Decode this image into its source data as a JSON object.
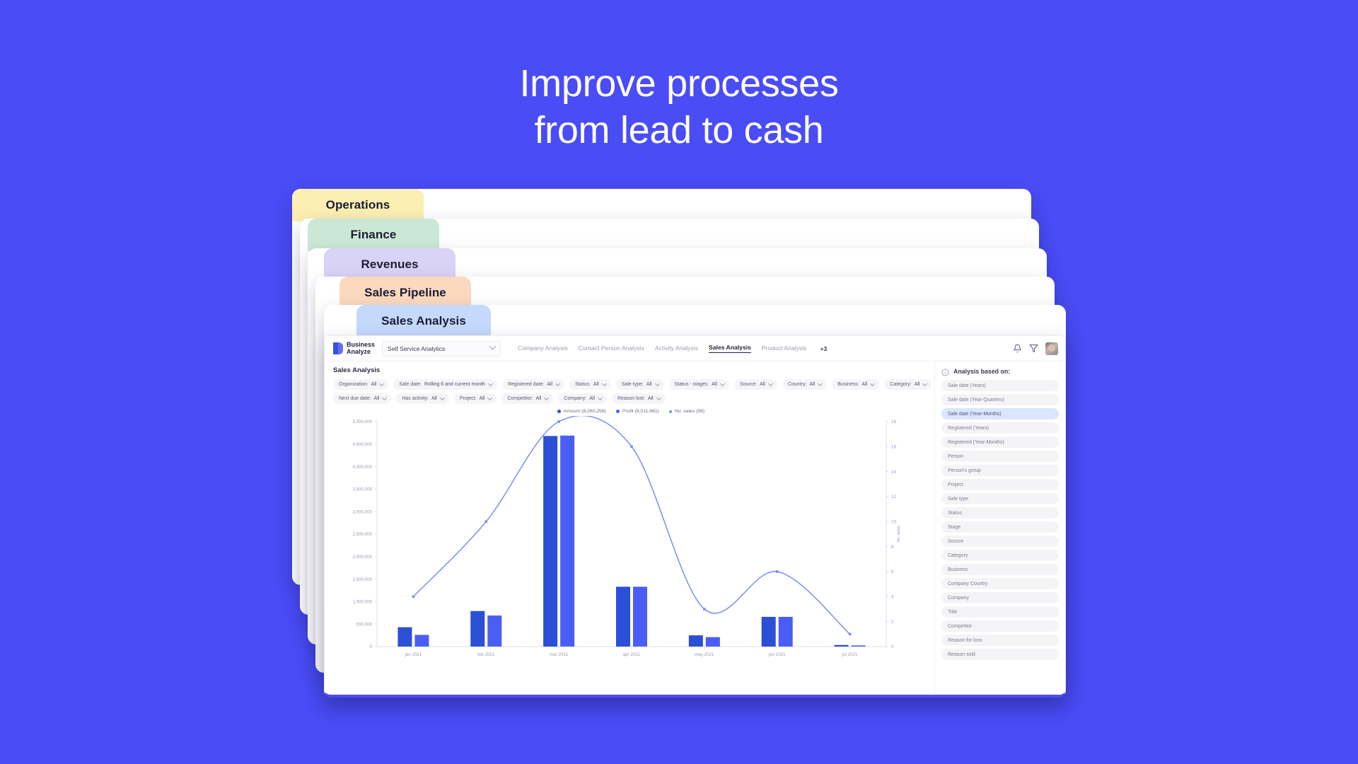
{
  "headline": {
    "line1": "Improve processes",
    "line2": "from lead to cash"
  },
  "stack_cards": [
    {
      "label": "Operations",
      "color": "#fbefb2"
    },
    {
      "label": "Finance",
      "color": "#cbe8d6"
    },
    {
      "label": "Revenues",
      "color": "#d9d3f7"
    },
    {
      "label": "Sales Pipeline",
      "color": "#fbd9bf"
    },
    {
      "label": "Sales Analysis",
      "color": "#c4d9fb"
    }
  ],
  "app": {
    "brand": {
      "line1": "Business",
      "line2": "Analyze"
    },
    "workspace_select": {
      "value": "Self Service Analytics"
    },
    "nav": [
      {
        "label": "Company Analysis",
        "active": false
      },
      {
        "label": "Contact Person Analysis",
        "active": false
      },
      {
        "label": "Activity Analysis",
        "active": false
      },
      {
        "label": "Sales Analysis",
        "active": true
      },
      {
        "label": "Product Analysis",
        "active": false
      }
    ],
    "nav_overflow": "+3",
    "header_icons": [
      "bell-icon",
      "filter-icon",
      "avatar"
    ],
    "page_title": "Sales Analysis",
    "filters_row1": [
      {
        "label": "Organization:",
        "value": "All"
      },
      {
        "label": "Sale date:",
        "value": "Rolling 6 and current month"
      },
      {
        "label": "Registered date:",
        "value": "All"
      },
      {
        "label": "Status:",
        "value": "All"
      },
      {
        "label": "Sale type:",
        "value": "All"
      },
      {
        "label": "Status - stages:",
        "value": "All"
      },
      {
        "label": "Source:",
        "value": "All"
      },
      {
        "label": "Country:",
        "value": "All"
      },
      {
        "label": "Business:",
        "value": "All"
      },
      {
        "label": "Category:",
        "value": "All"
      }
    ],
    "filters_row2": [
      {
        "label": "Next due date:",
        "value": "All"
      },
      {
        "label": "Has activity:",
        "value": "All"
      },
      {
        "label": "Project:",
        "value": "All"
      },
      {
        "label": "Competitor:",
        "value": "All"
      },
      {
        "label": "Company:",
        "value": "All"
      },
      {
        "label": "Reason lost:",
        "value": "All"
      }
    ],
    "sidebar": {
      "title": "Analysis based on:",
      "items": [
        {
          "label": "Sale date (Years)",
          "selected": false
        },
        {
          "label": "Sale date (Year-Quarters)",
          "selected": false
        },
        {
          "label": "Sale date (Year-Months)",
          "selected": true
        },
        {
          "label": "Registered (Years)",
          "selected": false
        },
        {
          "label": "Registered (Year-Months)",
          "selected": false
        },
        {
          "label": "Person",
          "selected": false
        },
        {
          "label": "Person's group",
          "selected": false
        },
        {
          "label": "Project",
          "selected": false
        },
        {
          "label": "Sale type",
          "selected": false
        },
        {
          "label": "Status",
          "selected": false
        },
        {
          "label": "Stage",
          "selected": false
        },
        {
          "label": "Source",
          "selected": false
        },
        {
          "label": "Category",
          "selected": false
        },
        {
          "label": "Business",
          "selected": false
        },
        {
          "label": "Company Country",
          "selected": false
        },
        {
          "label": "Company",
          "selected": false
        },
        {
          "label": "Title",
          "selected": false
        },
        {
          "label": "Competitor",
          "selected": false
        },
        {
          "label": "Reason for loss",
          "selected": false
        },
        {
          "label": "Reason sold",
          "selected": false
        }
      ]
    }
  },
  "colors": {
    "page_background": "#4a4cf5",
    "amount_bar": "#2b4fd6",
    "profit_bar": "#4a5ef5",
    "line": "#7a8df0",
    "accent": "#4a4cf5"
  },
  "chart_data": {
    "type": "bar",
    "title": "",
    "xlabel": "",
    "ylabel": "",
    "y2label": "No. sales",
    "categories": [
      "jan 2021",
      "feb 2021",
      "mar 2021",
      "apr 2021",
      "may 2021",
      "jun 2021",
      "jul 2021"
    ],
    "ylim": [
      0,
      5000000
    ],
    "yticks": [
      "0",
      "500,000",
      "1,000,000",
      "1,500,000",
      "2,000,000",
      "2,500,000",
      "3,000,000",
      "3,500,000",
      "4,000,000",
      "4,500,000",
      "5,000,000"
    ],
    "y2lim": [
      0,
      18
    ],
    "y2ticks": [
      "0",
      "2",
      "4",
      "6",
      "8",
      "10",
      "12",
      "14",
      "16",
      "18"
    ],
    "grid": false,
    "legend_position": "top-center",
    "series": [
      {
        "name": "Amount",
        "total": "8,260,258",
        "legend_label": "Amount (8,260,258)",
        "type": "bar",
        "color": "#2b4fd6",
        "values": [
          430000,
          790000,
          4680000,
          1330000,
          250000,
          660000,
          35000
        ]
      },
      {
        "name": "Profit",
        "total": "8,011,861",
        "legend_label": "Profit (8,011,861)",
        "type": "bar",
        "color": "#4a5ef5",
        "values": [
          260000,
          690000,
          4690000,
          1330000,
          210000,
          660000,
          25000
        ]
      },
      {
        "name": "No. sales",
        "total": "58",
        "legend_label": "No. sales (58)",
        "type": "line",
        "color": "#7a8df0",
        "axis": "y2",
        "values": [
          4,
          10,
          18,
          16,
          3,
          6,
          1
        ]
      }
    ]
  }
}
